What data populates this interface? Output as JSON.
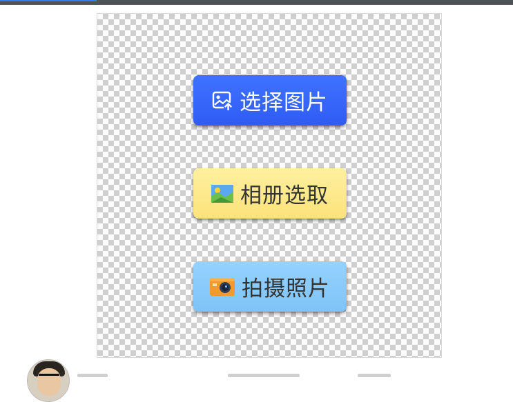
{
  "buttons": {
    "select_image": {
      "label": "选择图片",
      "icon": "image-upload-icon",
      "color": "#3a6bff"
    },
    "album_pick": {
      "label": "相册选取",
      "icon": "landscape-photo-icon",
      "color": "#fde98a"
    },
    "take_photo": {
      "label": "拍摄照片",
      "icon": "camera-icon",
      "color": "#8bccfb"
    }
  },
  "canvas": {
    "background": "transparent-checkerboard"
  },
  "colors": {
    "top_bar": "#4f5256",
    "top_accent": "#2f7ff0"
  }
}
